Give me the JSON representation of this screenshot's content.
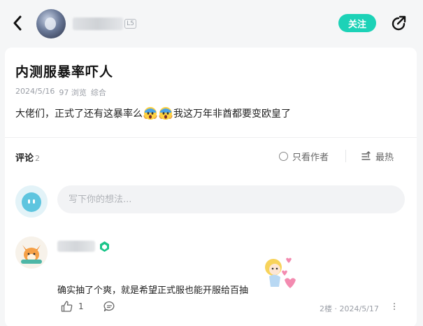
{
  "header": {
    "level_badge": "L5",
    "follow_label": "关注"
  },
  "post": {
    "title": "内测服暴率吓人",
    "date": "2024/5/16",
    "views": "97 浏览",
    "category": "综合",
    "body_part1": "大佬们，正式了还有这暴率么",
    "body_part2": "我这万年非酋都要变欧皇了",
    "emoji_icon": "scream-emoji-icon"
  },
  "comments": {
    "label": "评论",
    "count": "2",
    "only_author_label": "只看作者",
    "sort_label": "最热",
    "input_placeholder": "写下你的想法..."
  },
  "comment_item": {
    "text": "确实抽了个爽，就是希望正式服也能开服给百抽",
    "likes": "1",
    "floor_date": "2楼 · 2024/5/17"
  },
  "colors": {
    "accent": "#1cd2b7",
    "badge_green": "#1cc58a"
  }
}
